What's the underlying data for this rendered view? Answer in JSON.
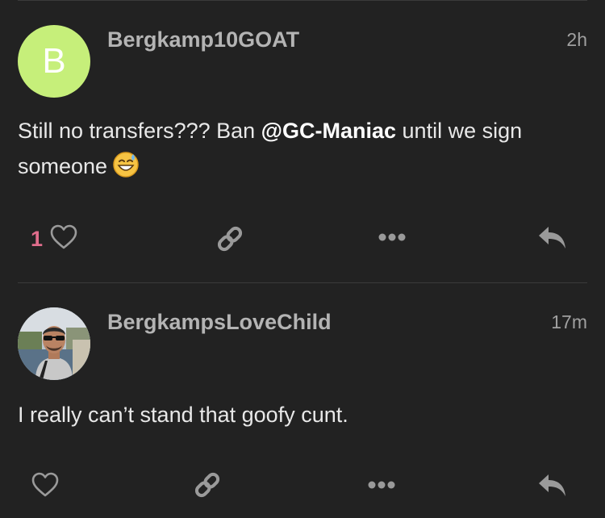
{
  "posts": [
    {
      "username": "Bergkamp10GOAT",
      "avatar_letter": "B",
      "avatar_color": "#c6ef7a",
      "time": "2h",
      "body_before": "Still no transfers??? Ban ",
      "mention": "@GC-Maniac",
      "body_after": " until we sign someone",
      "emoji": "grinning-face-with-sweat-icon",
      "likes": "1",
      "actions": [
        "heart-icon",
        "link-icon",
        "more-icon",
        "reply-icon"
      ]
    },
    {
      "username": "BergkampsLoveChild",
      "avatar": "user-photo",
      "time": "17m",
      "body": "I really can’t stand that goofy cunt.",
      "actions": [
        "heart-icon",
        "link-icon",
        "more-icon",
        "reply-icon"
      ]
    }
  ],
  "colors": {
    "background": "#222222",
    "like_count": "#e06d8c",
    "icon": "#9a9a9a"
  }
}
